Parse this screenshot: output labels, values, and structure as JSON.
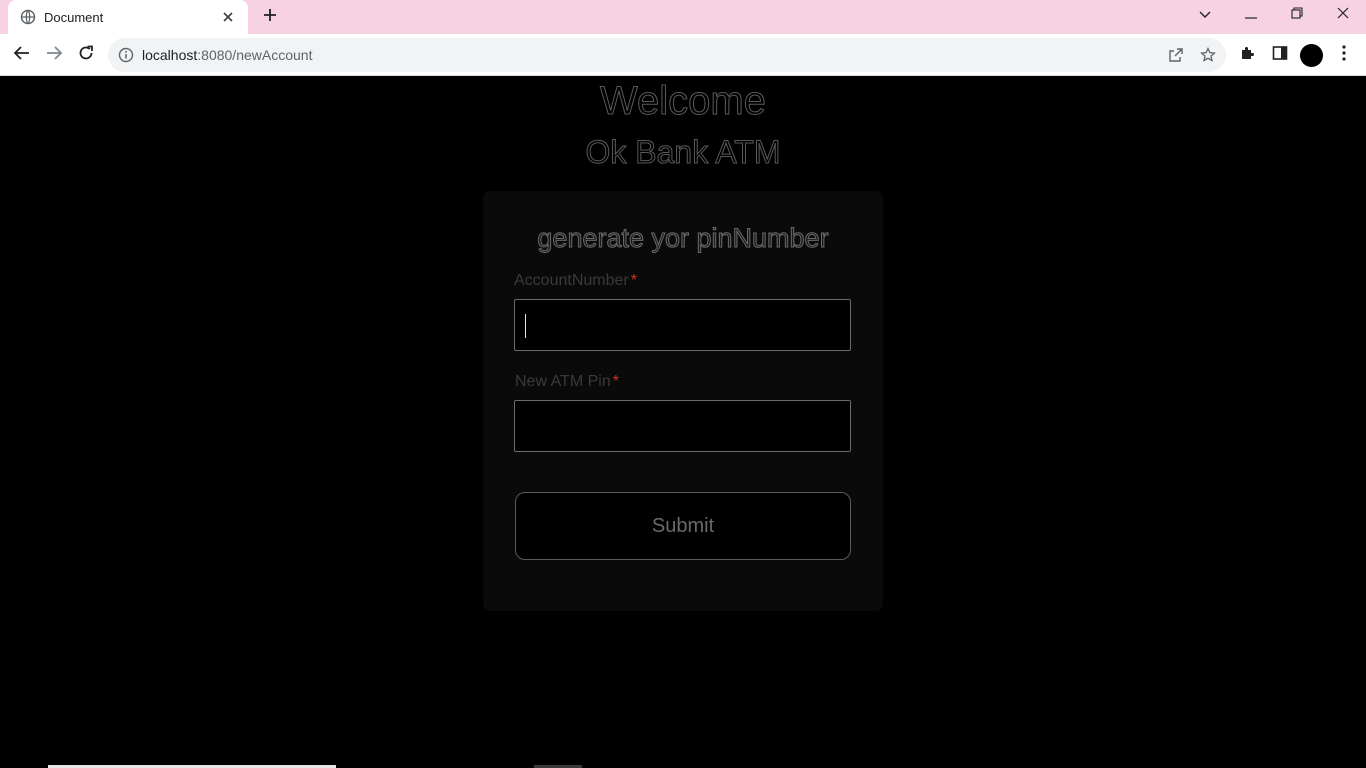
{
  "browser": {
    "tab_title": "Document",
    "url_host": "localhost",
    "url_path": ":8080/newAccount",
    "icons": {
      "favicon": "globe-icon",
      "tab_close": "close-icon",
      "new_tab": "plus-icon",
      "tab_search": "chevron-down-icon",
      "minimize": "minimize-icon",
      "restore": "restore-icon",
      "close_window": "close-icon",
      "back": "arrow-left-icon",
      "forward": "arrow-right-icon",
      "reload": "reload-icon",
      "site_info": "info-icon",
      "share": "share-icon",
      "bookmark": "star-icon",
      "extensions": "puzzle-icon",
      "side_panel": "side-panel-icon",
      "menu": "kebab-menu-icon"
    }
  },
  "page": {
    "welcome": "Welcome",
    "bank_name": "Ok Bank ATM",
    "form": {
      "title": "generate yor pinNumber",
      "account_label": "AccountNumber",
      "account_value": "",
      "pin_label": "New ATM Pin",
      "pin_value": "",
      "required_mark": "*",
      "submit_label": "Submit"
    }
  },
  "colors": {
    "tabstrip": "#f6d2e2",
    "page_bg": "#000000",
    "card_bg": "#0a0a0a",
    "required": "#d93025"
  }
}
